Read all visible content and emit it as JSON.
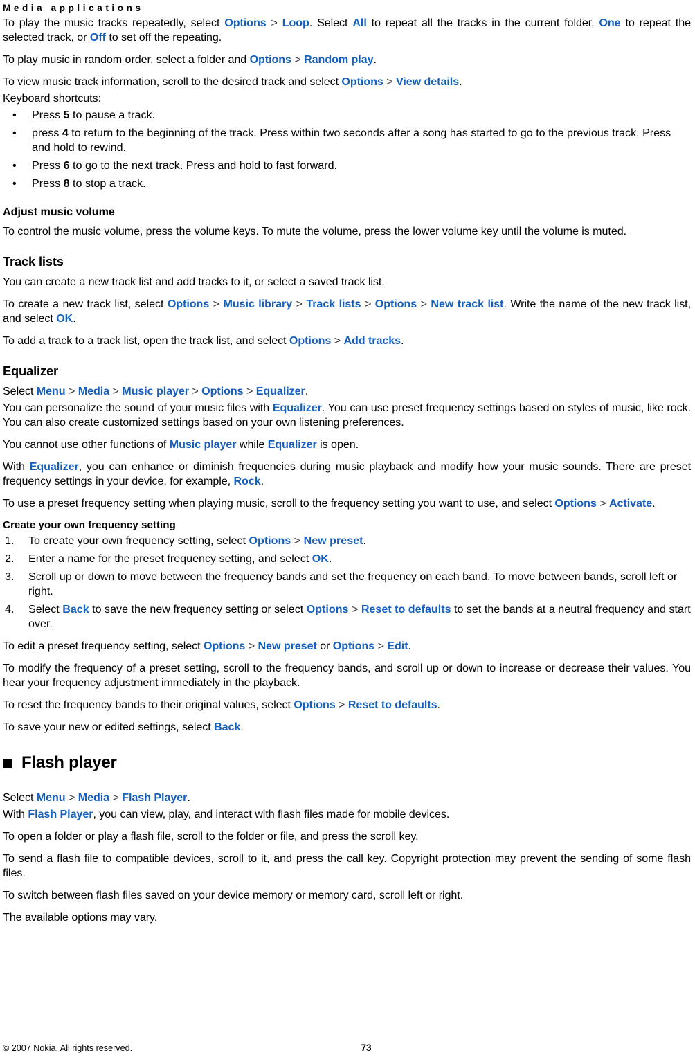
{
  "header": {
    "running_title": "Media applications"
  },
  "colors": {
    "ui_term_blue": "#1560bd",
    "text_black": "#000000",
    "page_background": "#ffffff"
  },
  "content": {
    "para_loop": {
      "t1": "To play the music tracks repeatedly, select ",
      "ui1": "Options",
      "sep1": " > ",
      "ui2": "Loop",
      "t2": ". Select ",
      "ui3": "All",
      "t3": " to repeat all the tracks in the current folder, ",
      "ui4": "One",
      "t4": " to repeat the selected track, or ",
      "ui5": "Off",
      "t5": " to set off the repeating."
    },
    "para_random": {
      "t1": "To play music in random order, select a folder and ",
      "ui1": "Options",
      "sep1": " > ",
      "ui2": "Random play",
      "t2": "."
    },
    "para_viewdetails": {
      "t1": "To view music track information, scroll to the desired track and select ",
      "ui1": "Options",
      "sep1": " > ",
      "ui2": "View details",
      "t2": "."
    },
    "keyboard_shortcuts_label": "Keyboard shortcuts:",
    "shortcuts": [
      {
        "bullet": "•",
        "t1": "Press ",
        "key": "5",
        "t2": " to pause a track."
      },
      {
        "bullet": "•",
        "t1": "press ",
        "key": "4",
        "t2": " to return to the beginning of the track. Press within two seconds after a song has started to go to the previous track. Press and hold to rewind."
      },
      {
        "bullet": "•",
        "t1": "Press ",
        "key": "6",
        "t2": " to go to the next track. Press and hold to fast forward."
      },
      {
        "bullet": "•",
        "t1": "Press ",
        "key": "8",
        "t2": " to stop a track."
      }
    ],
    "heading_adjust_volume": "Adjust music volume",
    "para_volume": "To control the music volume, press the volume keys. To mute the volume, press the lower volume key until the volume is muted.",
    "heading_track_lists": "Track lists",
    "para_tracklists_intro": "You can create a new track list and add tracks to it, or select a saved track list.",
    "para_create_tracklist": {
      "t1": "To create a new track list, select ",
      "ui1": "Options",
      "sep1": " > ",
      "ui2": "Music library",
      "sep2": " > ",
      "ui3": "Track lists",
      "sep3": " > ",
      "ui4": "Options",
      "sep4": " > ",
      "ui5": "New track list",
      "t2": ". Write the name of the new track list, and select ",
      "ui6": "OK",
      "t3": "."
    },
    "para_add_track": {
      "t1": "To add a track to a track list, open the track list, and select ",
      "ui1": "Options",
      "sep1": " > ",
      "ui2": "Add tracks",
      "t2": "."
    },
    "heading_equalizer": "Equalizer",
    "para_eq_path": {
      "t1": "Select ",
      "ui1": "Menu",
      "sep1": " > ",
      "ui2": "Media",
      "sep2": " > ",
      "ui3": "Music player",
      "sep3": " > ",
      "ui4": "Options",
      "sep4": " > ",
      "ui5": "Equalizer",
      "t2": "."
    },
    "para_eq_personalize": {
      "t1": "You can personalize the sound of your music files with ",
      "ui1": "Equalizer",
      "t2": ". You can use preset frequency settings based on styles of music, like rock. You can also create customized settings based on your own listening preferences."
    },
    "para_eq_cannot": {
      "t1": "You cannot use other functions of ",
      "ui1": "Music player",
      "t2": " while ",
      "ui2": "Equalizer",
      "t3": " is open."
    },
    "para_eq_with": {
      "t1": "With ",
      "ui1": "Equalizer",
      "t2": ", you can enhance or diminish frequencies during music playback and modify how your music sounds. There are preset frequency settings in your device, for example, ",
      "ui2": "Rock",
      "t3": "."
    },
    "para_eq_preset_use": {
      "t1": "To use a preset frequency setting when playing music, scroll to the frequency setting you want to use, and select ",
      "ui1": "Options",
      "sep1": " > ",
      "ui2": "Activate",
      "t2": "."
    },
    "heading_create_own": "Create your own frequency setting",
    "steps": [
      {
        "num": "1.",
        "t1": "To create your own frequency setting, select ",
        "ui1": "Options",
        "sep1": " > ",
        "ui2": "New preset",
        "t2": "."
      },
      {
        "num": "2.",
        "t1": "Enter a name for the preset frequency setting, and select ",
        "ui1": "OK",
        "t2": "."
      },
      {
        "num": "3.",
        "t1": "Scroll up or down to move between the frequency bands and set the frequency on each band. To move between bands, scroll left or right.",
        "ui1": "",
        "sep1": "",
        "ui2": "",
        "t2": ""
      },
      {
        "num": "4.",
        "t1": "Select ",
        "ui1": "Back",
        "t2": " to save the new frequency setting or select ",
        "ui2": "Options",
        "sep2": " > ",
        "ui3": "Reset to defaults",
        "t3": " to set the bands at a neutral frequency and start over."
      }
    ],
    "para_edit_preset": {
      "t1": "To edit a preset frequency setting, select ",
      "ui1": "Options",
      "sep1": " > ",
      "ui2": "New preset",
      "t2": " or ",
      "ui3": "Options",
      "sep2": " > ",
      "ui4": "Edit",
      "t3": "."
    },
    "para_modify_freq": "To modify the frequency of a preset setting, scroll to the frequency bands, and scroll up or down to increase or decrease their values. You hear your frequency adjustment immediately in the playback.",
    "para_reset_bands": {
      "t1": "To reset the frequency bands to their original values, select ",
      "ui1": "Options",
      "sep1": " > ",
      "ui2": "Reset to defaults",
      "t2": "."
    },
    "para_save_settings": {
      "t1": "To save your new or edited settings, select ",
      "ui1": "Back",
      "t2": "."
    },
    "heading_flash_player": "Flash player",
    "para_flash_path": {
      "t1": "Select ",
      "ui1": "Menu",
      "sep1": " > ",
      "ui2": "Media",
      "sep2": " > ",
      "ui3": "Flash Player",
      "t2": "."
    },
    "para_flash_with": {
      "t1": "With ",
      "ui1": "Flash Player",
      "t2": ", you can view, play, and interact with flash files made for mobile devices."
    },
    "para_flash_open": "To open a folder or play a flash file, scroll to the folder or file, and press the scroll key.",
    "para_flash_send": "To send a flash file to compatible devices, scroll to it, and press the call key. Copyright protection may prevent the sending of some flash files.",
    "para_flash_switch": "To switch between flash files saved on your device memory or memory card, scroll left or right.",
    "para_flash_options": "The available options may vary."
  },
  "footer": {
    "copyright": "© 2007 Nokia. All rights reserved.",
    "page_number": "73"
  }
}
